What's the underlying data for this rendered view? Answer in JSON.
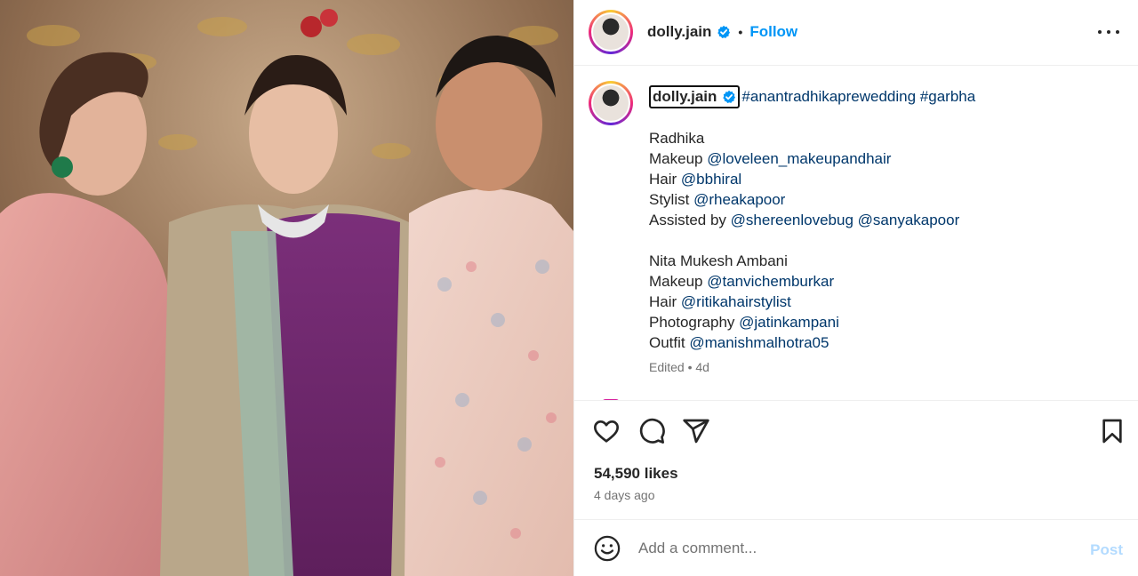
{
  "post": {
    "username": "dolly.jain",
    "follow_label": "Follow",
    "separator": "•",
    "verified_icon": "verified-badge-icon",
    "more_icon": "more-options-icon"
  },
  "caption": {
    "username": "dolly.jain",
    "hashtags": "#anantradhikaprewedding #garbha",
    "section1": {
      "name": "Radhika",
      "makeup_label": "Makeup",
      "makeup_mention": "@loveleen_makeupandhair",
      "hair_label": "Hair",
      "hair_mention": "@bbhiral",
      "stylist_label": "Stylist",
      "stylist_mention": "@rheakapoor",
      "assisted_label": "Assisted by",
      "assisted_mention1": "@shereenlovebug",
      "assisted_mention2": "@sanyakapoor"
    },
    "section2": {
      "name": "Nita Mukesh Ambani",
      "makeup_label": "Makeup",
      "makeup_mention": "@tanvichemburkar",
      "hair_label": "Hair",
      "hair_mention": "@ritikahairstylist",
      "photo_label": "Photography",
      "photo_mention": "@jatinkampani",
      "outfit_label": "Outfit",
      "outfit_mention": "@manishmalhotra05"
    },
    "edited": "Edited",
    "edited_sep": "•",
    "edited_time": "4d"
  },
  "actions": {
    "like_icon": "heart-icon",
    "comment_icon": "comment-icon",
    "share_icon": "share-icon",
    "save_icon": "bookmark-icon",
    "likes": "54,590 likes",
    "time_ago": "4 days ago"
  },
  "comment_box": {
    "placeholder": "Add a comment...",
    "post_label": "Post",
    "emoji_icon": "emoji-icon"
  },
  "colors": {
    "link_blue": "#0095f6",
    "mention_blue": "#00376b",
    "post_disabled": "#b3dbff",
    "muted": "#737373"
  }
}
